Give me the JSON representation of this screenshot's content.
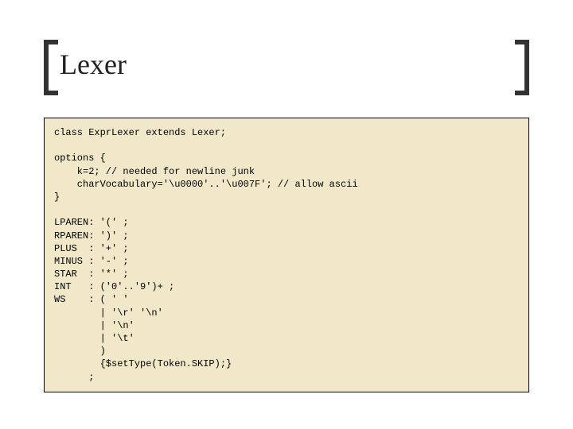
{
  "slide": {
    "title": "Lexer",
    "code": "class ExprLexer extends Lexer;\n\noptions {\n    k=2; // needed for newline junk\n    charVocabulary='\\u0000'..'\\u007F'; // allow ascii\n}\n\nLPAREN: '(' ;\nRPAREN: ')' ;\nPLUS  : '+' ;\nMINUS : '-' ;\nSTAR  : '*' ;\nINT   : ('0'..'9')+ ;\nWS    : ( ' '\n        | '\\r' '\\n'\n        | '\\n'\n        | '\\t'\n        )\n        {$setType(Token.SKIP);}\n      ;"
  }
}
